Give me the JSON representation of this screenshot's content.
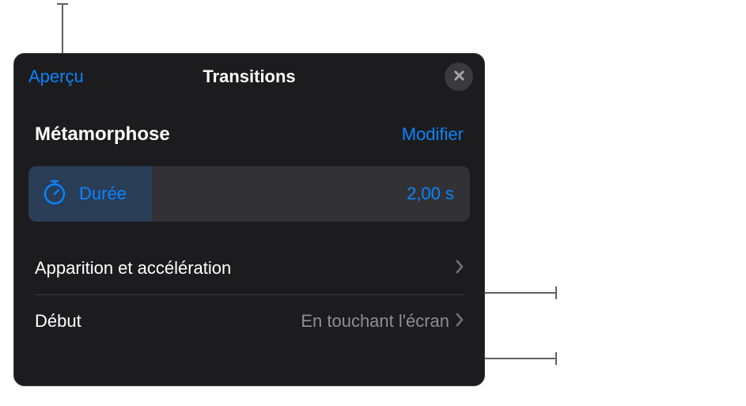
{
  "header": {
    "preview_label": "Aperçu",
    "title": "Transitions"
  },
  "transition": {
    "name": "Métamorphose",
    "modify_label": "Modifier"
  },
  "duration": {
    "label": "Durée",
    "value": "2,00 s"
  },
  "rows": {
    "easing": {
      "label": "Apparition et accélération"
    },
    "start": {
      "label": "Début",
      "value": "En touchant l'écran"
    }
  }
}
